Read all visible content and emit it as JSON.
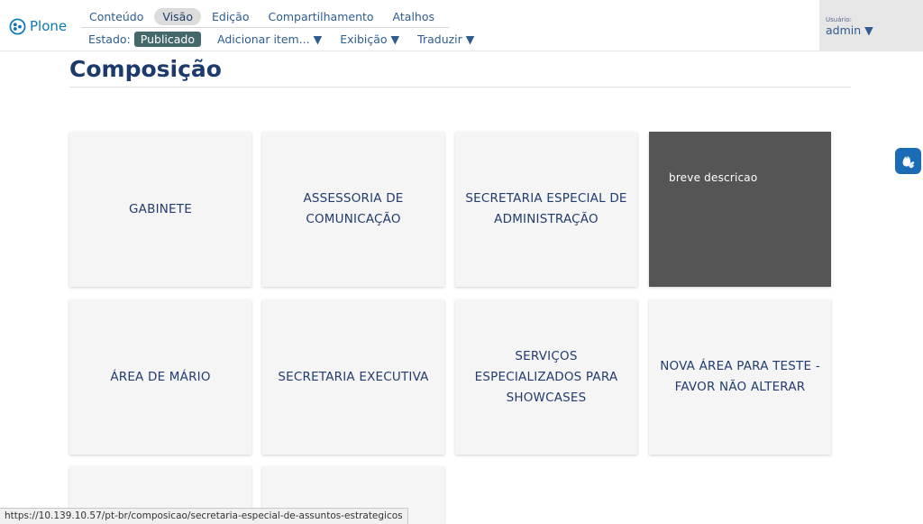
{
  "brand": {
    "name": "Plone"
  },
  "toolbar": {
    "tabs": [
      {
        "label": "Conteúdo",
        "active": false
      },
      {
        "label": "Visão",
        "active": true
      },
      {
        "label": "Edição",
        "active": false
      },
      {
        "label": "Compartilhamento",
        "active": false
      },
      {
        "label": "Atalhos",
        "active": false
      }
    ],
    "state_label": "Estado:",
    "state_value": "Publicado",
    "actions": [
      {
        "label": "Adicionar item... ▼"
      },
      {
        "label": "Exibição ▼"
      },
      {
        "label": "Traduzir ▼"
      }
    ]
  },
  "user": {
    "label": "Usuário:",
    "name": "admin ▼"
  },
  "page": {
    "title": "Composição"
  },
  "cards": [
    {
      "label": "GABINETE"
    },
    {
      "label": "ASSESSORIA DE COMUNICAÇÃO"
    },
    {
      "label": "SECRETARIA ESPECIAL DE ADMINISTRAÇÃO"
    },
    {
      "label": "breve descricao",
      "dark": true
    },
    {
      "label": "ÁREA DE MÁRIO"
    },
    {
      "label": "SECRETARIA EXECUTIVA"
    },
    {
      "label": "SERVIÇOS ESPECIALIZADOS PARA SHOWCASES"
    },
    {
      "label": "NOVA ÁREA PARA TESTE - FAVOR NÃO ALTERAR"
    },
    {
      "label": ""
    },
    {
      "label": ""
    }
  ],
  "statusbar": {
    "url": "https://10.139.10.57/pt-br/composicao/secretaria-especial-de-assuntos-estrategicos"
  },
  "colors": {
    "brand": "#0a77b8",
    "heading": "#1c3a6a",
    "state_badge": "#45686a",
    "dark_card": "#555555",
    "a11y_button": "#1c6bb5"
  },
  "icons": {
    "logo": "plone-logo-icon",
    "accessibility": "sign-language-hands-icon"
  }
}
